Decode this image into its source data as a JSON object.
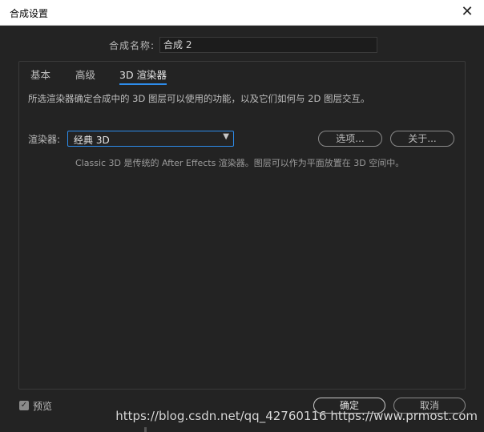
{
  "window": {
    "title": "合成设置",
    "close_glyph": "✕"
  },
  "comp_name": {
    "label": "合成名称:",
    "value": "合成 2"
  },
  "tabs": [
    {
      "label": "基本"
    },
    {
      "label": "高级"
    },
    {
      "label": "3D 渲染器",
      "active": true
    }
  ],
  "renderer_tab": {
    "description": "所选渲染器确定合成中的 3D 图层可以使用的功能，以及它们如何与 2D 图层交互。",
    "renderer_label": "渲染器:",
    "renderer_value": "经典 3D",
    "options_button": "选项...",
    "about_button": "关于...",
    "info_text": "Classic 3D 是传统的 After Effects 渲染器。图层可以作为平面放置在 3D 空间中。"
  },
  "footer": {
    "preview_label": "预览",
    "preview_checked": true,
    "ok_button": "确定",
    "cancel_button": "取消"
  },
  "watermark": "https://blog.csdn.net/qq_42760116  https://www.prmost.com",
  "colors": {
    "accent": "#2d8ceb",
    "background": "#232323"
  }
}
